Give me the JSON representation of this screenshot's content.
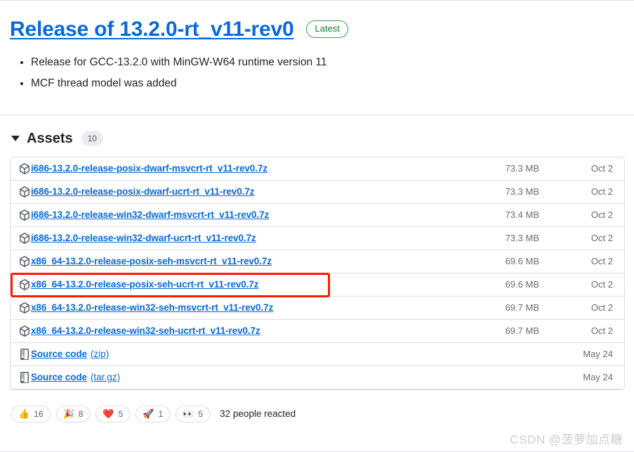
{
  "release": {
    "title": "Release of 13.2.0-rt_v11-rev0",
    "badge": "Latest",
    "notes": [
      "Release for GCC-13.2.0 with MinGW-W64 runtime version 11",
      "MCF thread model was added"
    ]
  },
  "assets": {
    "heading": "Assets",
    "count": "10",
    "rows": [
      {
        "icon": "package-icon",
        "name": "i686-13.2.0-release-posix-dwarf-msvcrt-rt_v11-rev0.7z",
        "suffix": "",
        "size": "73.3 MB",
        "date": "Oct 2",
        "highlighted": false
      },
      {
        "icon": "package-icon",
        "name": "i686-13.2.0-release-posix-dwarf-ucrt-rt_v11-rev0.7z",
        "suffix": "",
        "size": "73.3 MB",
        "date": "Oct 2",
        "highlighted": false
      },
      {
        "icon": "package-icon",
        "name": "i686-13.2.0-release-win32-dwarf-msvcrt-rt_v11-rev0.7z",
        "suffix": "",
        "size": "73.4 MB",
        "date": "Oct 2",
        "highlighted": false
      },
      {
        "icon": "package-icon",
        "name": "i686-13.2.0-release-win32-dwarf-ucrt-rt_v11-rev0.7z",
        "suffix": "",
        "size": "73.3 MB",
        "date": "Oct 2",
        "highlighted": false
      },
      {
        "icon": "package-icon",
        "name": "x86_64-13.2.0-release-posix-seh-msvcrt-rt_v11-rev0.7z",
        "suffix": "",
        "size": "69.6 MB",
        "date": "Oct 2",
        "highlighted": false
      },
      {
        "icon": "package-icon",
        "name": "x86_64-13.2.0-release-posix-seh-ucrt-rt_v11-rev0.7z",
        "suffix": "",
        "size": "69.6 MB",
        "date": "Oct 2",
        "highlighted": true
      },
      {
        "icon": "package-icon",
        "name": "x86_64-13.2.0-release-win32-seh-msvcrt-rt_v11-rev0.7z",
        "suffix": "",
        "size": "69.7 MB",
        "date": "Oct 2",
        "highlighted": false
      },
      {
        "icon": "package-icon",
        "name": "x86_64-13.2.0-release-win32-seh-ucrt-rt_v11-rev0.7z",
        "suffix": "",
        "size": "69.7 MB",
        "date": "Oct 2",
        "highlighted": false
      },
      {
        "icon": "file-zip-icon",
        "name": "Source code",
        "suffix": "(zip)",
        "size": "",
        "date": "May 24",
        "highlighted": false
      },
      {
        "icon": "file-zip-icon",
        "name": "Source code",
        "suffix": "(tar.gz)",
        "size": "",
        "date": "May 24",
        "highlighted": false
      }
    ]
  },
  "reactions": {
    "items": [
      {
        "emoji": "👍",
        "name": "thumbs-up",
        "count": "16"
      },
      {
        "emoji": "🎉",
        "name": "party-popper",
        "count": "8"
      },
      {
        "emoji": "❤️",
        "name": "heart",
        "count": "5"
      },
      {
        "emoji": "🚀",
        "name": "rocket",
        "count": "1"
      },
      {
        "emoji": "👀",
        "name": "eyes",
        "count": "5"
      }
    ],
    "summary": "32 people reacted"
  },
  "watermark": "CSDN @菠萝加点糖",
  "colors": {
    "link": "#0969da",
    "badge_green": "#2da44e",
    "highlight_red": "#ff1a00",
    "muted_text": "#636c76",
    "border": "#d8dee4"
  }
}
